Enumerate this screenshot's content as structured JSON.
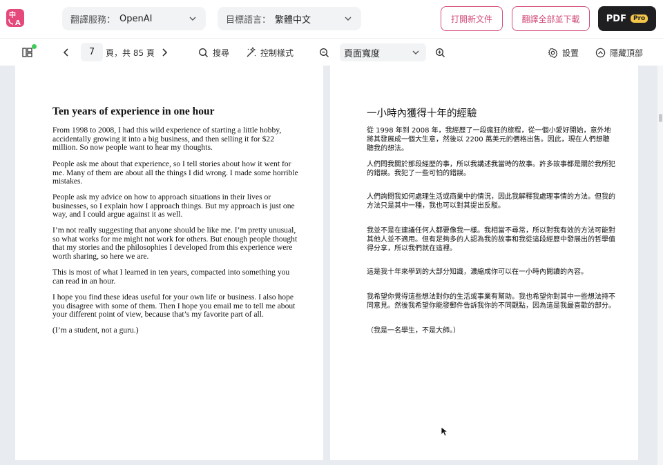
{
  "header": {
    "logo_text": "中\nA",
    "service": {
      "label": "翻譯服務：",
      "value": "OpenAI"
    },
    "target_lang": {
      "label": "目標語言：",
      "value": "繁體中文"
    },
    "open_btn": "打開新文件",
    "download_btn": "翻譯全部並下載",
    "pdf_btn": "PDF",
    "pro_badge": "Pro"
  },
  "toolbar": {
    "page_current": "7",
    "page_total": "頁，共 85 頁",
    "search": "搜尋",
    "control_style": "控制樣式",
    "zoom_value": "頁面寬度",
    "settings": "設置",
    "hide_top": "隱藏頂部"
  },
  "document": {
    "en_title": "Ten years of experience in one hour",
    "en_paragraphs": [
      "From 1998 to 2008, I had this wild experience of starting a little hobby, accidentally growing it into a big business, and then selling it for $22 million. So now people want to hear my thoughts.",
      "People ask me about that experience, so I tell stories about how it went for me. Many of them are about all the things I did wrong. I made some horrible mistakes.",
      "People ask my advice on how to approach situations in their lives or businesses, so I explain how I approach things. But my approach is just one way, and I could argue against it as well.",
      "I’m not really suggesting that anyone should be like me. I’m pretty unusual, so what works for me might not work for others. But enough people thought that my stories and the philosophies I developed from this experience were worth sharing, so here we are.",
      "This is most of what I learned in ten years, compacted into something you can read in an hour.",
      "I hope you find these ideas useful for your own life or business. I also hope you disagree with some of them. Then I hope you email me to tell me about your different point of view, because that’s my favorite part of all.",
      "(I’m a student, not a guru.)"
    ],
    "zh_title": "一小時內獲得十年的經驗",
    "zh_paragraphs": [
      "從 1998 年到 2008 年，我經歷了一段瘋狂的旅程，從一個小愛好開始，意外地將其發展成一個大生意，然後以 2200 萬美元的價格出售。因此，現在人們想聽聽我的想法。",
      "人們問我關於那段經歷的事，所以我講述我當時的故事。許多故事都是關於我所犯的錯誤。我犯了一些可怕的錯誤。",
      "人們詢問我如何處理生活或商業中的情況，因此我解釋我處理事情的方法。但我的方法只是其中一種，我也可以對其提出反駁。",
      "我並不是在建議任何人都要像我一樣。我相當不尋常，所以對我有效的方法可能對其他人並不適用。但有足夠多的人認為我的故事和我從這段經歷中發展出的哲學值得分享，所以我們就在這裡。",
      "這是我十年來學到的大部分知識，濃縮成你可以在一小時內閱讀的內容。",
      "我希望你覺得這些想法對你的生活或事業有幫助。我也希望你對其中一些想法持不同意見。然後我希望你能發郵件告訴我你的不同觀點，因為這是我最喜歡的部分。",
      "（我是一名學生，不是大師。）"
    ]
  },
  "colors": {
    "accent": "#d24e77",
    "logo": "#e5487a",
    "pro": "#f3c64a",
    "dark_btn": "#1f1f22",
    "status_dot": "#3ecb5a"
  }
}
